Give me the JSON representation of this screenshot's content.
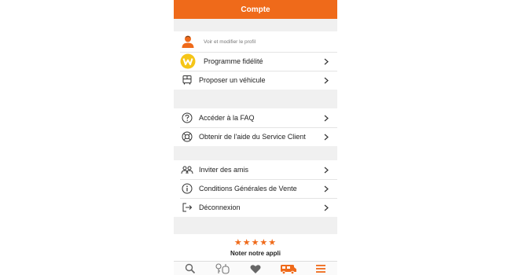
{
  "header": {
    "title": "Compte"
  },
  "colors": {
    "accent": "#ef6a1a",
    "loyalty": "#f5c518"
  },
  "sections": {
    "account": {
      "profile": {
        "label": "Voir et modifier le profil",
        "icon": "user-avatar-icon"
      },
      "loyalty": {
        "label": "Programme fidélité",
        "icon": "loyalty-badge-icon"
      },
      "propose": {
        "label": "Proposer un véhicule",
        "icon": "camper-van-icon"
      }
    },
    "help": {
      "faq": {
        "label": "Accéder à la FAQ",
        "icon": "question-icon"
      },
      "support": {
        "label": "Obtenir de l'aide du Service Client",
        "icon": "lifebuoy-icon"
      }
    },
    "other": {
      "invite": {
        "label": "Inviter des amis",
        "icon": "friends-icon"
      },
      "terms": {
        "label": "Conditions Générales de Vente",
        "icon": "info-icon"
      },
      "logout": {
        "label": "Déconnexion",
        "icon": "logout-icon"
      }
    }
  },
  "rating": {
    "stars": "★★★★★",
    "label": "Noter notre appli",
    "star_count": 5
  },
  "tabbar": {
    "items": [
      {
        "icon": "search-icon",
        "active": false
      },
      {
        "icon": "keys-icon",
        "active": false
      },
      {
        "icon": "heart-icon",
        "active": false
      },
      {
        "icon": "camper-icon",
        "active": true
      },
      {
        "icon": "menu-icon",
        "active": true
      }
    ]
  }
}
